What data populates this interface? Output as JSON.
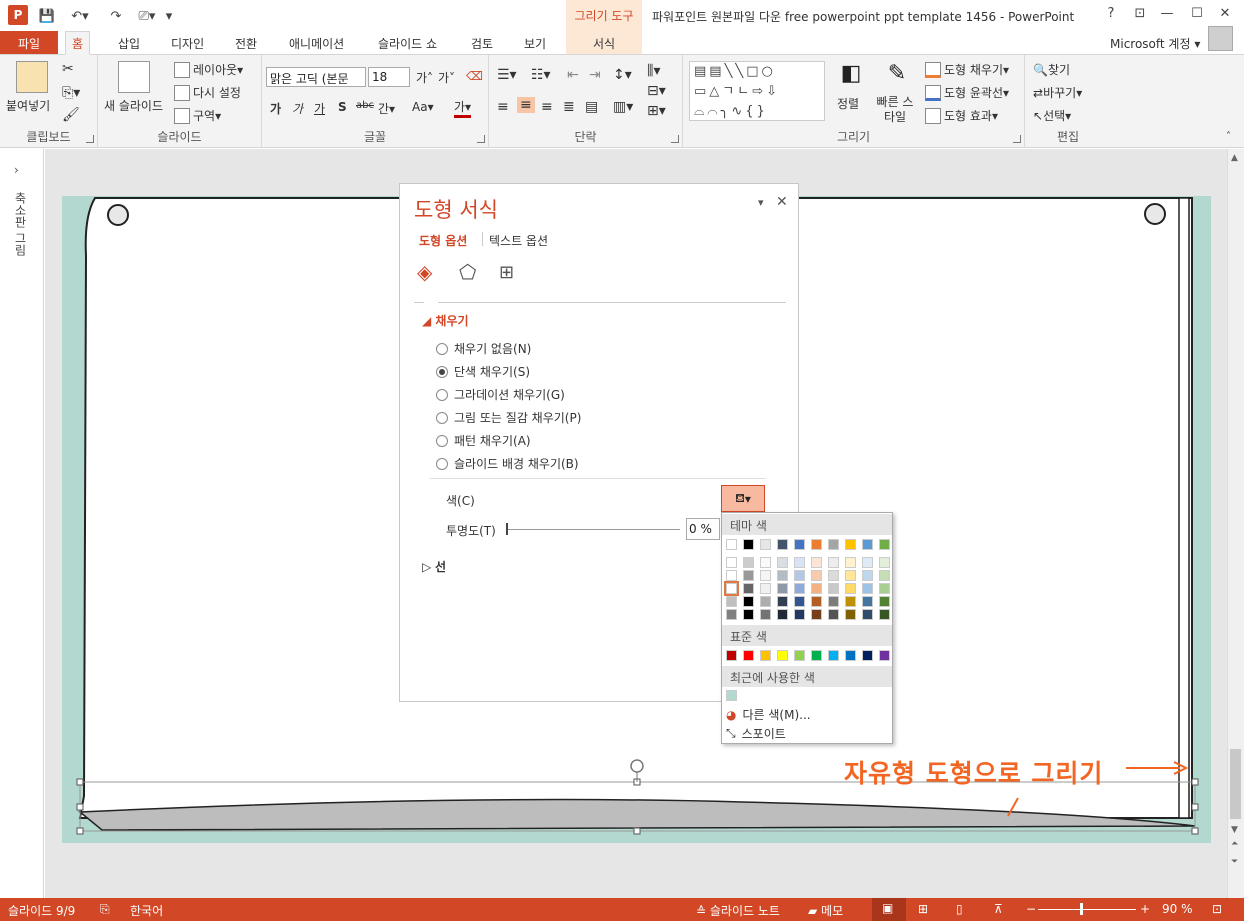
{
  "app": {
    "icon_letter": "P",
    "title": "파워포인트 원본파일 다운 free powerpoint ppt template 1456 - PowerPoint",
    "tool_context": "그리기 도구",
    "account": "Microsoft 계정"
  },
  "tabs": [
    "파일",
    "홈",
    "삽입",
    "디자인",
    "전환",
    "애니메이션",
    "슬라이드 쇼",
    "검토",
    "보기",
    "서식"
  ],
  "ribbon": {
    "clipboard": {
      "label": "클립보드",
      "paste": "붙여넣기"
    },
    "slides": {
      "label": "슬라이드",
      "new_slide": "새 슬라이드",
      "layout": "레이아웃",
      "reset": "다시 설정",
      "section": "구역"
    },
    "font": {
      "label": "글꼴",
      "font_name": "맑은 고딕 (본문",
      "font_size": "18",
      "bold": "가",
      "italic": "가",
      "underline": "가",
      "shadow": "S",
      "strike": "abc",
      "spacing": "간",
      "case": "Aa",
      "color": "가"
    },
    "paragraph": {
      "label": "단락"
    },
    "drawing": {
      "label": "그리기",
      "arrange": "정렬",
      "quick_styles": "빠른 스타일",
      "fill": "도형 채우기",
      "outline": "도형 윤곽선",
      "effects": "도형 효과"
    },
    "editing": {
      "label": "편집",
      "find": "찾기",
      "replace": "바꾸기",
      "select": "선택"
    }
  },
  "left_pane": {
    "label": "축소판 그림"
  },
  "format_panel": {
    "title": "도형 서식",
    "tabs": [
      "도형 옵션",
      "텍스트 옵션"
    ],
    "section_fill": "채우기",
    "fill_options": [
      "채우기 없음(N)",
      "단색 채우기(S)",
      "그라데이션 채우기(G)",
      "그림 또는 질감 채우기(P)",
      "패턴 채우기(A)",
      "슬라이드 배경 채우기(B)"
    ],
    "selected_fill": 1,
    "color_label": "색(C)",
    "transparency_label": "투명도(T)",
    "transparency_value": "0 %",
    "section_line": "선"
  },
  "color_popup": {
    "theme_header": "테마 색",
    "standard_header": "표준 색",
    "recent_header": "최근에 사용한 색",
    "more_colors": "다른 색(M)...",
    "eyedropper": "스포이트",
    "theme_colors": [
      "#ffffff",
      "#000000",
      "#e7e6e6",
      "#44546a",
      "#4472c4",
      "#ed7d31",
      "#a5a5a5",
      "#ffc000",
      "#5b9bd5",
      "#70ad47"
    ],
    "standard_colors": [
      "#c00000",
      "#ff0000",
      "#ffc000",
      "#ffff00",
      "#92d050",
      "#00b050",
      "#00b0f0",
      "#0070c0",
      "#002060",
      "#7030a0"
    ],
    "recent_colors": [
      "#b2d8d0"
    ]
  },
  "annotation": "자유형 도형으로 그리기",
  "status": {
    "slide": "슬라이드 9/9",
    "language": "한국어",
    "notes": "슬라이드 노트",
    "comments": "메모",
    "zoom": "90 %"
  },
  "colors": {
    "accent": "#d24726",
    "slide_bg": "#b2d8d0",
    "annotation": "#f26522"
  }
}
